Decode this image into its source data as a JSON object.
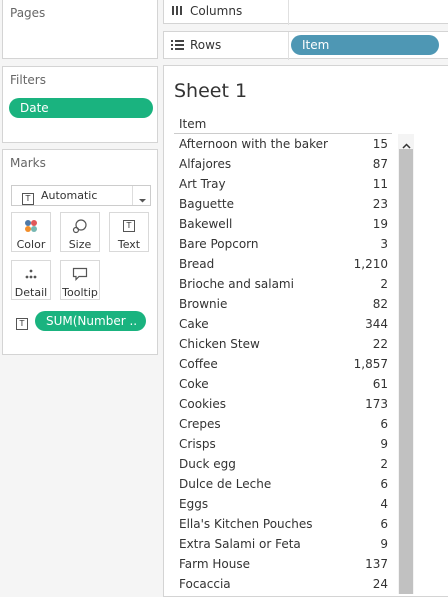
{
  "pages": {
    "title": "Pages"
  },
  "columns": {
    "label": "Columns"
  },
  "rows_shelf": {
    "label": "Rows",
    "pill": "Item"
  },
  "filters": {
    "title": "Filters",
    "pill": "Date"
  },
  "marks": {
    "title": "Marks",
    "type": "Automatic",
    "buttons": {
      "color": "Color",
      "size": "Size",
      "text": "Text",
      "detail": "Detail",
      "tooltip": "Tooltip"
    },
    "text_pill": "SUM(Number .."
  },
  "sheet": {
    "title": "Sheet 1",
    "column_header": "Item",
    "rows": [
      {
        "item": "Afternoon with the baker",
        "value": "15"
      },
      {
        "item": "Alfajores",
        "value": "87"
      },
      {
        "item": "Art Tray",
        "value": "11"
      },
      {
        "item": "Baguette",
        "value": "23"
      },
      {
        "item": "Bakewell",
        "value": "19"
      },
      {
        "item": "Bare Popcorn",
        "value": "3"
      },
      {
        "item": "Bread",
        "value": "1,210"
      },
      {
        "item": "Brioche and salami",
        "value": "2"
      },
      {
        "item": "Brownie",
        "value": "82"
      },
      {
        "item": "Cake",
        "value": "344"
      },
      {
        "item": "Chicken Stew",
        "value": "22"
      },
      {
        "item": "Coffee",
        "value": "1,857"
      },
      {
        "item": "Coke",
        "value": "61"
      },
      {
        "item": "Cookies",
        "value": "173"
      },
      {
        "item": "Crepes",
        "value": "6"
      },
      {
        "item": "Crisps",
        "value": "9"
      },
      {
        "item": "Duck egg",
        "value": "2"
      },
      {
        "item": "Dulce de Leche",
        "value": "6"
      },
      {
        "item": "Eggs",
        "value": "4"
      },
      {
        "item": "Ella's Kitchen Pouches",
        "value": "6"
      },
      {
        "item": "Extra Salami or Feta",
        "value": "9"
      },
      {
        "item": "Farm House",
        "value": "137"
      },
      {
        "item": "Focaccia",
        "value": "24"
      }
    ]
  }
}
